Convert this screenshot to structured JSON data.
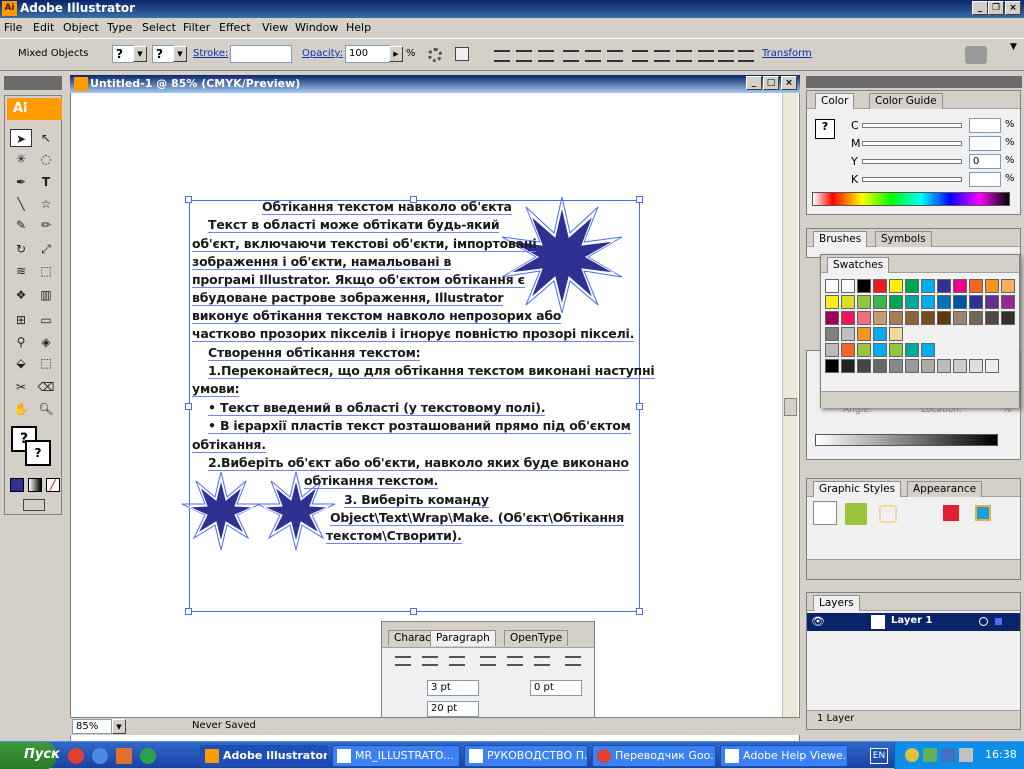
{
  "app": {
    "title": "Adobe Illustrator",
    "icon_text": "Ai"
  },
  "menu": [
    "File",
    "Edit",
    "Object",
    "Type",
    "Select",
    "Filter",
    "Effect",
    "View",
    "Window",
    "Help"
  ],
  "controlbar": {
    "selection_label": "Mixed Objects",
    "fill_value": "?",
    "stroke_value": "?",
    "stroke_label": "Stroke:",
    "opacity_label": "Opacity:",
    "opacity_value": "100",
    "opacity_unit": "%",
    "transform_label": "Transform"
  },
  "document": {
    "title": "Untitled-1 @ 85% (CMYK/Preview)",
    "zoom": "85%",
    "status": "Never Saved",
    "text_lines": [
      "Обтікання текстом навколо об'єкта",
      "Текст в області може обтікати будь-який",
      "об'єкт, включаючи текстові об'єкти, імпортовані",
      "зображення і об'єкти, намальовані в",
      "програмі Illustrаtоr. Якщо об'єктом обтікання є",
      "вбудоване растрове зображення, Illustrаtоr",
      "виконує обтікання текстом навколо непрозорих або",
      "частково прозорих пікселів і ігнорує повністю прозорі пікселі.",
      "Створення обтікання текстом:",
      "1.Переконайтеся, що для обтікання текстом виконані наступні",
      "умови:",
      "• Текст введений в області (у текстовому полі).",
      "• В ієрархії пластів текст розташований прямо під об'єктом",
      "обтікання.",
      "2.Виберіть об'єкт або об'єкти, навколо яких буде виконано",
      "обтікання текстом.",
      "3.     Виберіть команду",
      "Object\\Text\\Wrаp\\Mаke. (Об'єкт\\Обтікання",
      "текстом\\Створити)."
    ]
  },
  "panels": {
    "color": {
      "tabs": [
        "Color",
        "Color Guide"
      ],
      "channels": [
        "C",
        "M",
        "Y",
        "K"
      ],
      "values": [
        "",
        "",
        "0",
        ""
      ],
      "unit": "%"
    },
    "swatches": {
      "tab": "Swatches"
    },
    "brushes": {
      "tabs": [
        "Brushes",
        "Symbols"
      ]
    },
    "gradient": {
      "angle_label": "Angle:",
      "location_label": "Location:",
      "unit": "%"
    },
    "graphic_styles": {
      "tabs": [
        "Graphic Styles",
        "Appearance"
      ]
    },
    "layers": {
      "tab": "Layers",
      "layer_name": "Layer 1",
      "count": "1 Layer"
    },
    "paragraph": {
      "tabs": [
        "Charac",
        "Paragraph",
        "OpenType"
      ],
      "left_indent": "3 pt",
      "right_indent": "0 pt",
      "first_indent": "20 pt"
    }
  },
  "taskbar": {
    "start": "Пуск",
    "buttons": [
      "Adobe Illustrator",
      "MR_ILLUSTRATO...",
      "РУКОВОДСТВО П...",
      "Переводчик Goo...",
      "Adobe Help Viewe..."
    ],
    "lang": "EN",
    "time": "16:38"
  },
  "colors": {
    "titlebar": "#0a246a",
    "star": "#2e3192",
    "accent": "#ff9a00"
  }
}
